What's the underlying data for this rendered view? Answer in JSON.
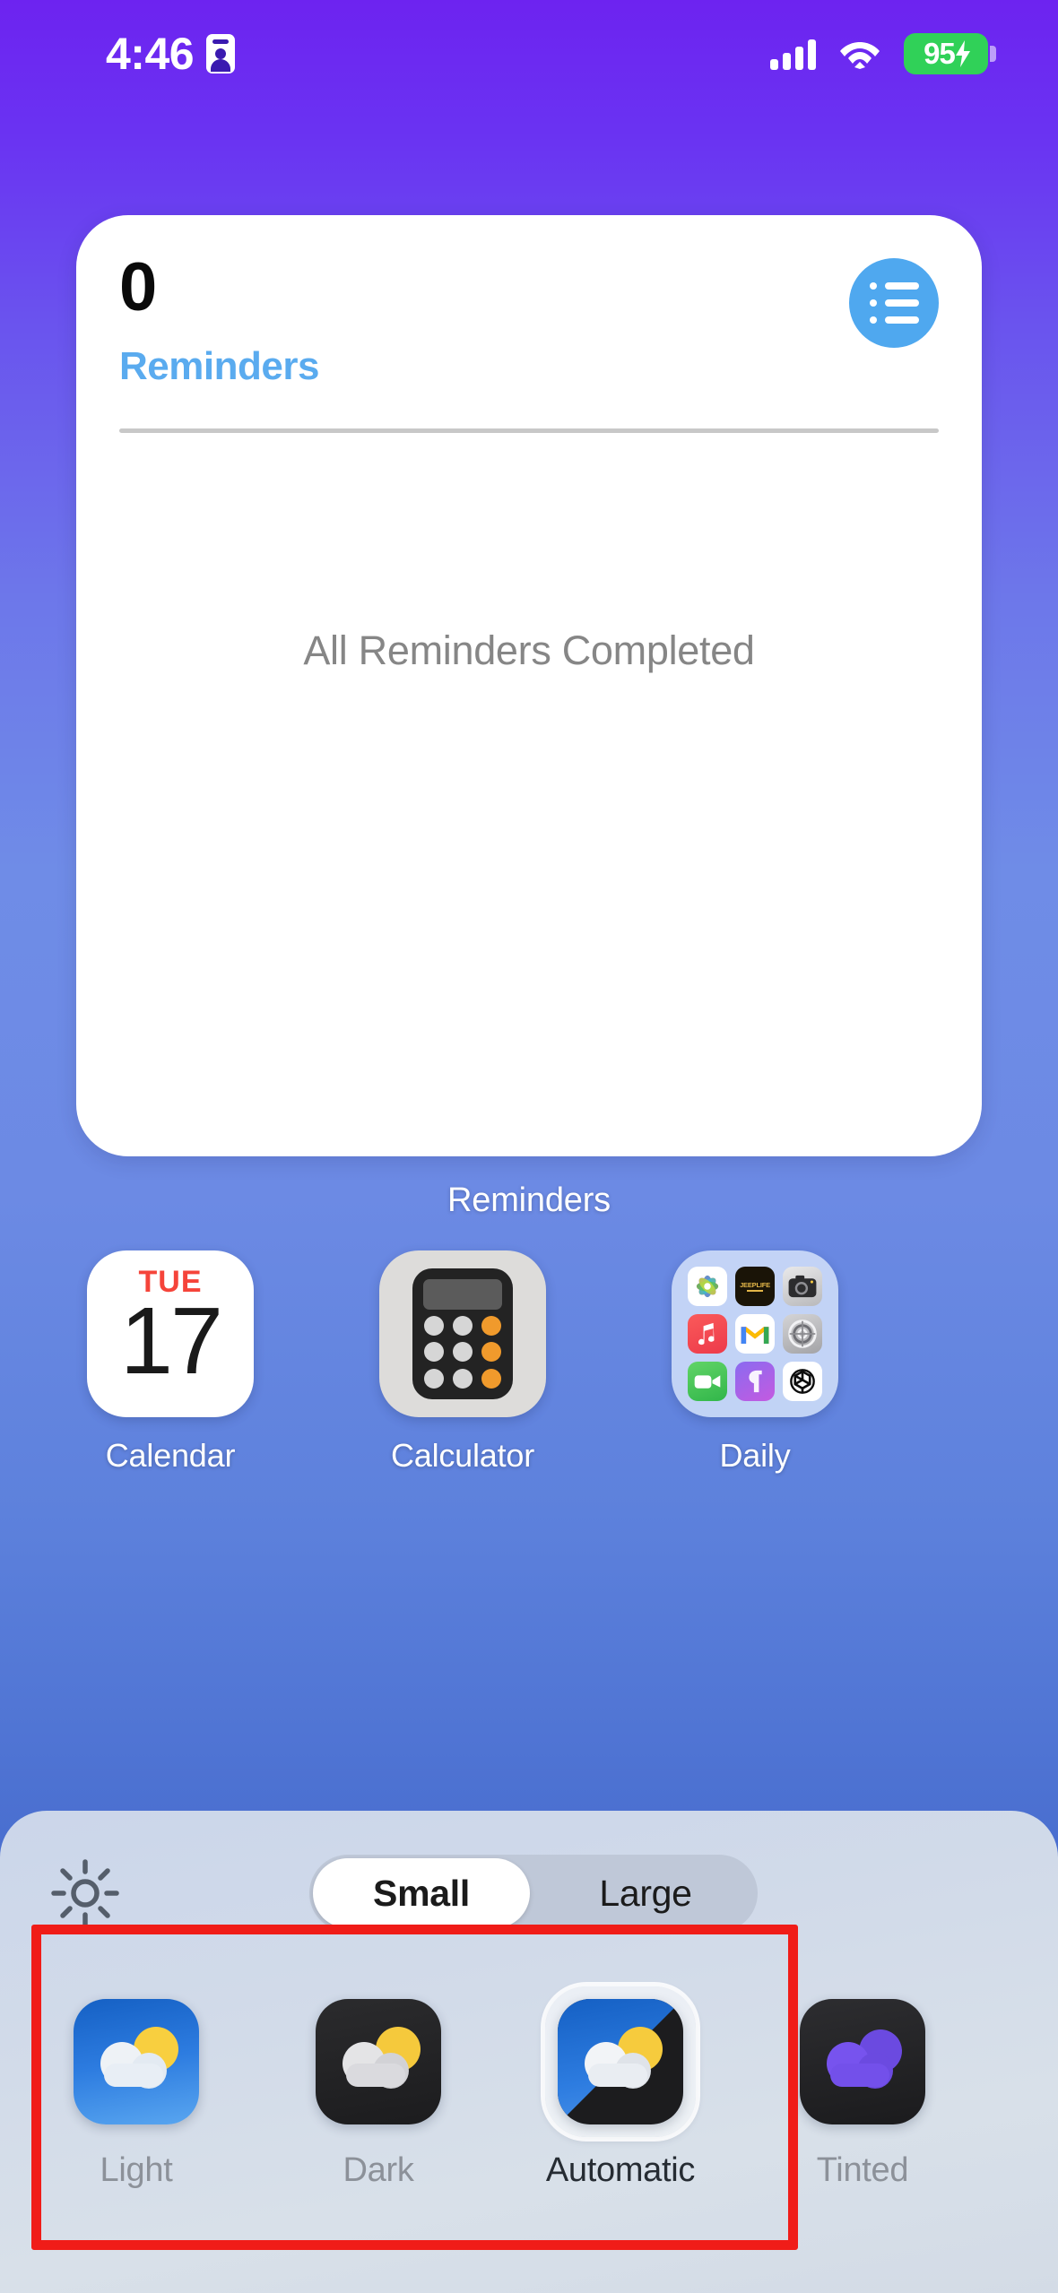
{
  "status_bar": {
    "time": "4:46",
    "recording_icon": "contact-card-icon",
    "signal_icon": "cellular-signal-icon",
    "wifi_icon": "wifi-icon",
    "battery_percent": "95",
    "battery_charging_icon": "lightning-bolt-icon",
    "battery_color": "#30d158"
  },
  "widget": {
    "count": "0",
    "title": "Reminders",
    "title_color": "#5aabef",
    "badge_icon": "bulleted-list-icon",
    "empty_message": "All Reminders Completed",
    "label": "Reminders"
  },
  "apps": [
    {
      "name": "Calendar",
      "icon": "calendar-icon",
      "day_of_week": "TUE",
      "day_number": "17",
      "dow_color": "#f5443a"
    },
    {
      "name": "Calculator",
      "icon": "calculator-icon"
    },
    {
      "name": "Daily",
      "icon": "folder-icon",
      "mini_icons": [
        "photos-icon",
        "jeeplife-icon",
        "camera-icon",
        "music-icon",
        "gmail-icon",
        "settings-icon",
        "facetime-icon",
        "shortcuts-icon",
        "chatgpt-icon"
      ],
      "jeeplife_text": "JEEPLIFE"
    }
  ],
  "panel": {
    "brightness_icon": "sun-brightness-icon",
    "size_segments": [
      {
        "label": "Small",
        "selected": true
      },
      {
        "label": "Large",
        "selected": false
      }
    ],
    "appearance_options": [
      {
        "label": "Light",
        "icon": "weather-light-icon",
        "selected": false
      },
      {
        "label": "Dark",
        "icon": "weather-dark-icon",
        "selected": false
      },
      {
        "label": "Automatic",
        "icon": "weather-automatic-icon",
        "selected": true
      },
      {
        "label": "Tinted",
        "icon": "weather-tinted-icon",
        "selected": false
      }
    ]
  },
  "annotation": {
    "color": "#f01c18",
    "shape": "rectangle-highlight"
  }
}
